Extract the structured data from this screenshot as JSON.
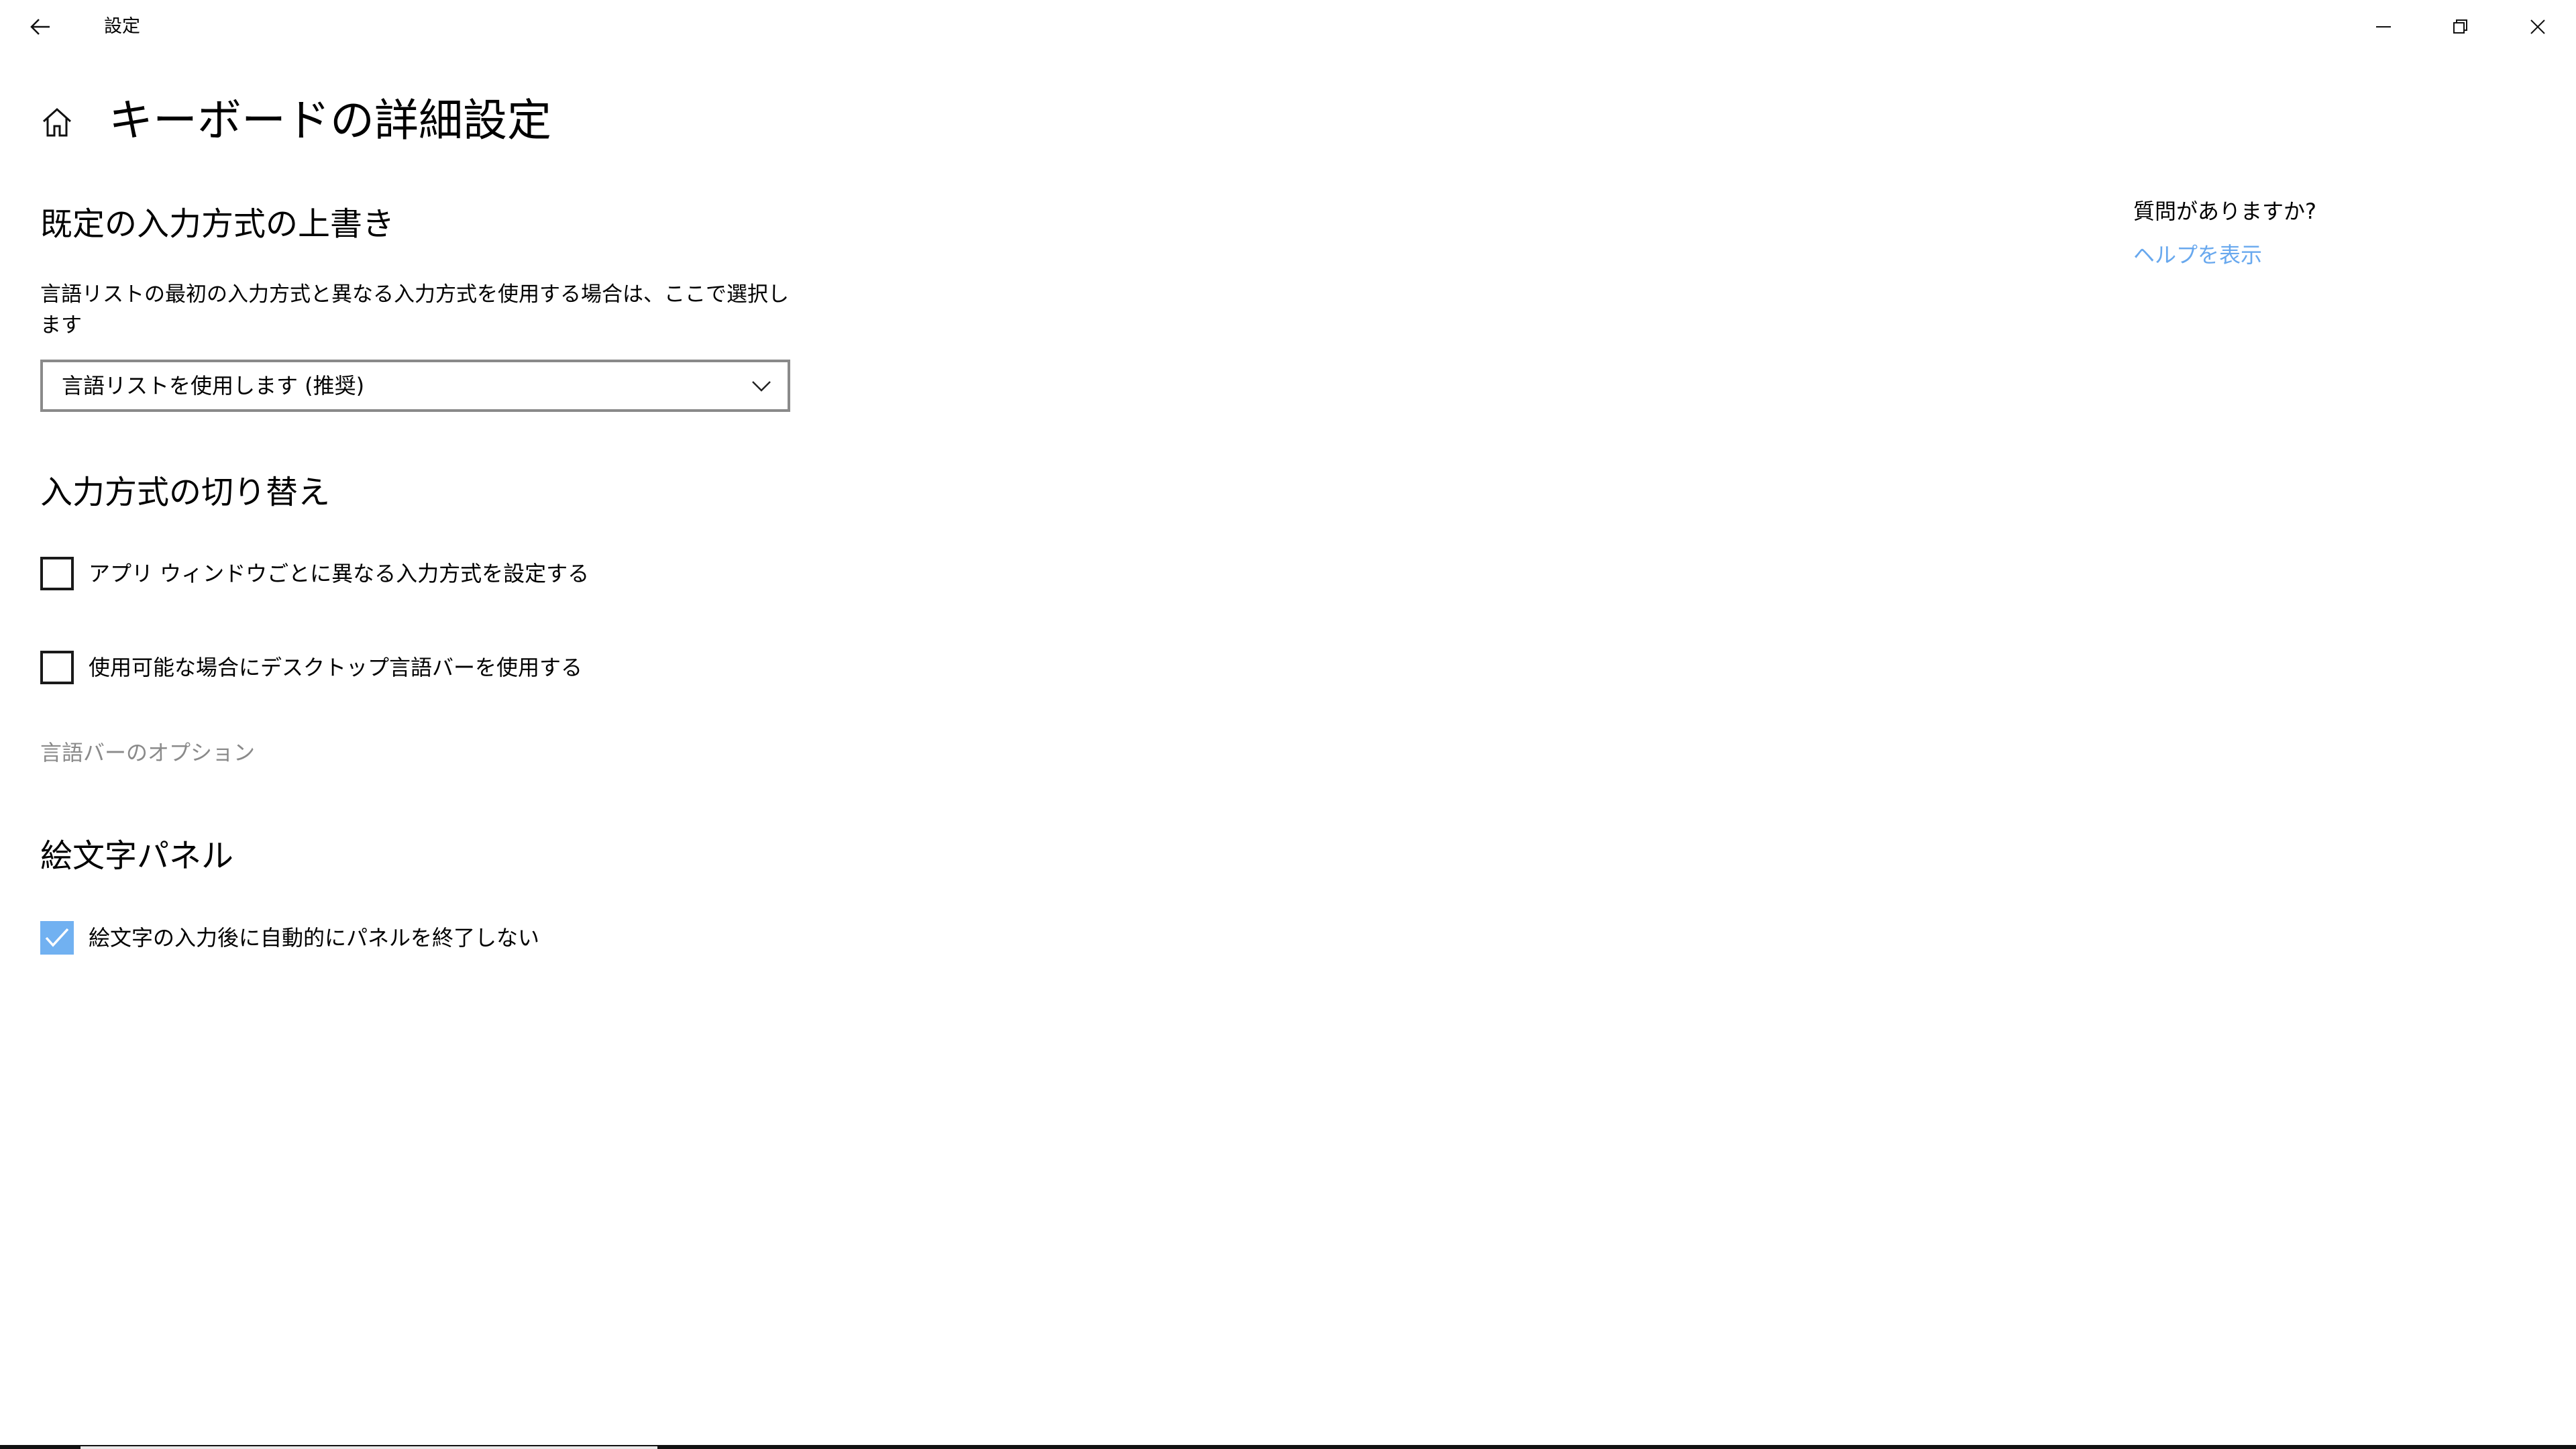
{
  "titlebar": {
    "title": "設定",
    "back_icon": "arrow-left-icon",
    "minimize_icon": "minimize-icon",
    "restore_icon": "restore-icon",
    "close_icon": "close-icon"
  },
  "header": {
    "home_icon": "home-icon",
    "page_title": "キーボードの詳細設定"
  },
  "override_section": {
    "heading": "既定の入力方式の上書き",
    "description": "言語リストの最初の入力方式と異なる入力方式を使用する場合は、ここで選択します",
    "dropdown_value": "言語リストを使用します (推奨)"
  },
  "switch_section": {
    "heading": "入力方式の切り替え",
    "options": [
      {
        "label": "アプリ ウィンドウごとに異なる入力方式を設定する",
        "checked": false
      },
      {
        "label": "使用可能な場合にデスクトップ言語バーを使用する",
        "checked": false
      }
    ],
    "language_bar_options_link": "言語バーのオプション"
  },
  "emoji_section": {
    "heading": "絵文字パネル",
    "options": [
      {
        "label": "絵文字の入力後に自動的にパネルを終了しない",
        "checked": true
      }
    ]
  },
  "help_pane": {
    "question": "質問がありますか?",
    "link": "ヘルプを表示"
  },
  "colors": {
    "accent_checkbox": "#71b1f1",
    "link": "#68a8ee",
    "disabled_text": "#8a8a8a",
    "dropdown_border": "#8a8a8a"
  }
}
